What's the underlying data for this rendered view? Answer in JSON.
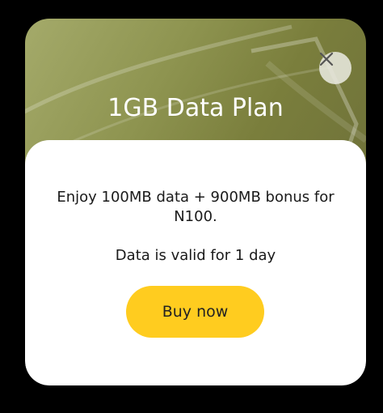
{
  "dialog": {
    "title": "1GB Data Plan",
    "description": "Enjoy 100MB data + 900MB bonus for N100.",
    "validity": "Data is valid for 1 day",
    "buy_button_label": "Buy now",
    "close_icon": "close-icon"
  },
  "colors": {
    "backdrop": "#000000",
    "banner": "#8e9450",
    "card": "#ffffff",
    "buy_button": "#ffcc1f"
  }
}
